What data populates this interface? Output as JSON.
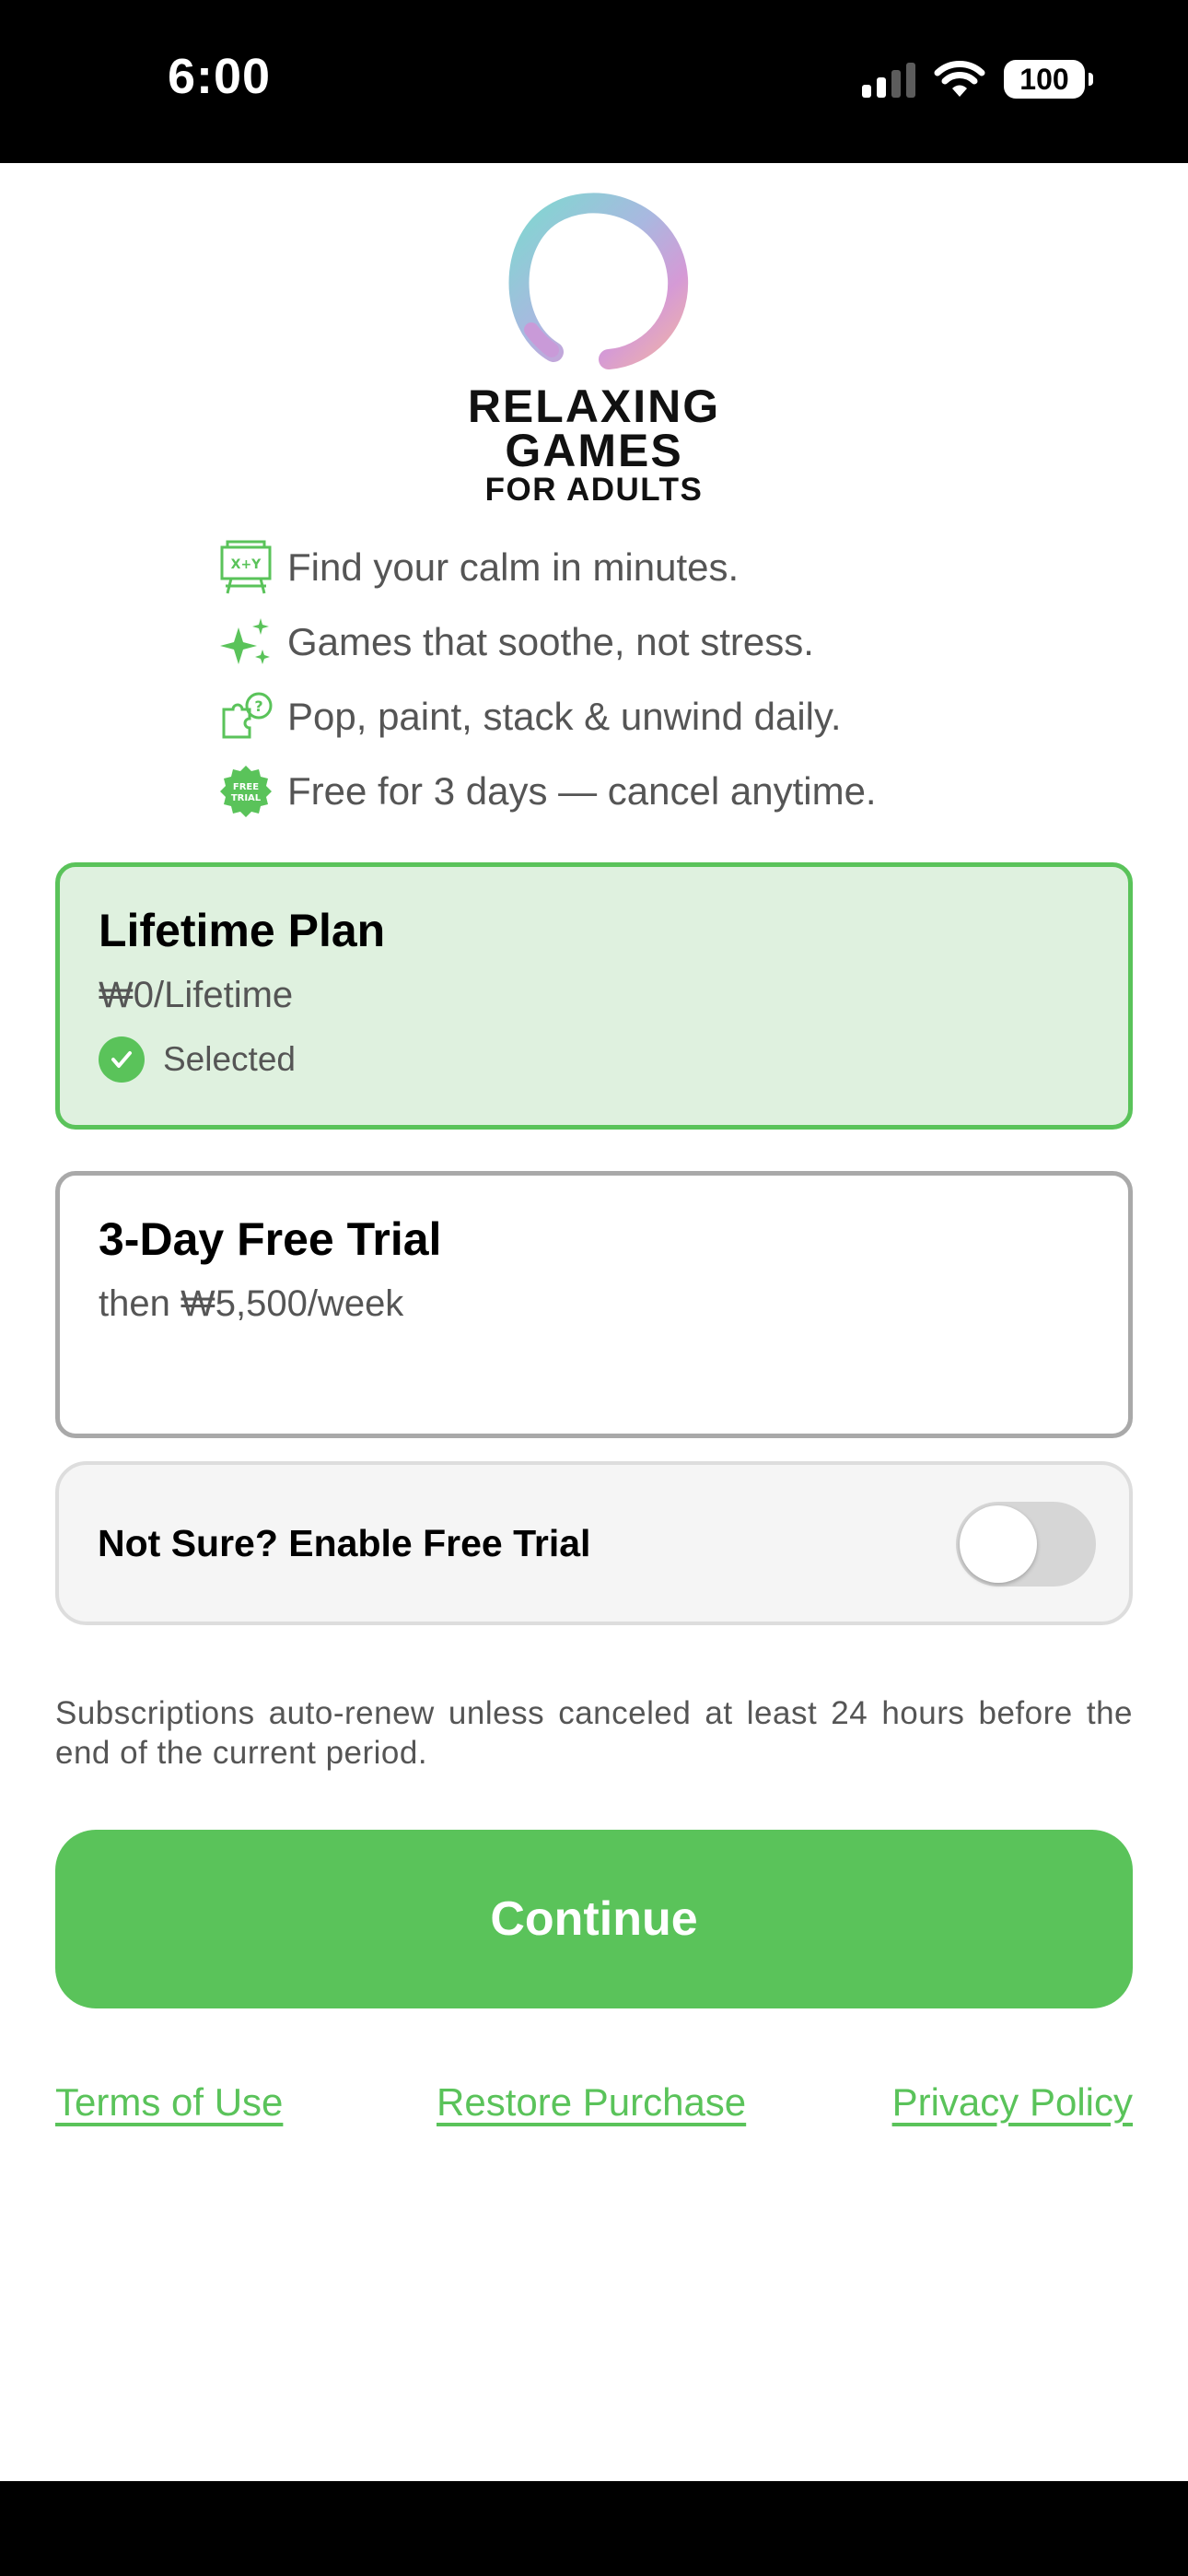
{
  "status_bar": {
    "time": "6:00",
    "battery": "100",
    "icons": [
      "cellular-signal-icon",
      "wifi-icon",
      "battery-icon"
    ]
  },
  "app": {
    "logo_icon": "enso-circle-logo",
    "title_line1": "RELAXING",
    "title_line2": "GAMES",
    "title_line3": "FOR ADULTS"
  },
  "features": [
    {
      "icon": "math-board-icon",
      "text": "Find your calm in minutes."
    },
    {
      "icon": "sparkles-icon",
      "text": "Games that soothe, not stress."
    },
    {
      "icon": "puzzle-brain-icon",
      "text": "Pop, paint, stack & unwind daily."
    },
    {
      "icon": "free-trial-badge-icon",
      "icon_text": "FREE TRIAL",
      "text": "Free for 3 days — cancel anytime."
    }
  ],
  "plans": [
    {
      "name": "Lifetime Plan",
      "price": "₩0/Lifetime",
      "selected": true,
      "selected_label": "Selected"
    },
    {
      "name": "3-Day Free Trial",
      "price": "then ₩5,500/week",
      "selected": false
    }
  ],
  "free_trial_toggle": {
    "label": "Not Sure? Enable Free Trial",
    "on": false
  },
  "disclaimer": "Subscriptions auto-renew unless canceled at least 24 hours before the end of the current period.",
  "continue_label": "Continue",
  "footer": {
    "terms": "Terms of Use",
    "restore": "Restore Purchase",
    "privacy": "Privacy Policy"
  },
  "colors": {
    "accent": "#5AC35A",
    "selected_bg": "#DFF1DF",
    "unselected_border": "#A9A9A9",
    "status_bar_bg": "#000000"
  }
}
